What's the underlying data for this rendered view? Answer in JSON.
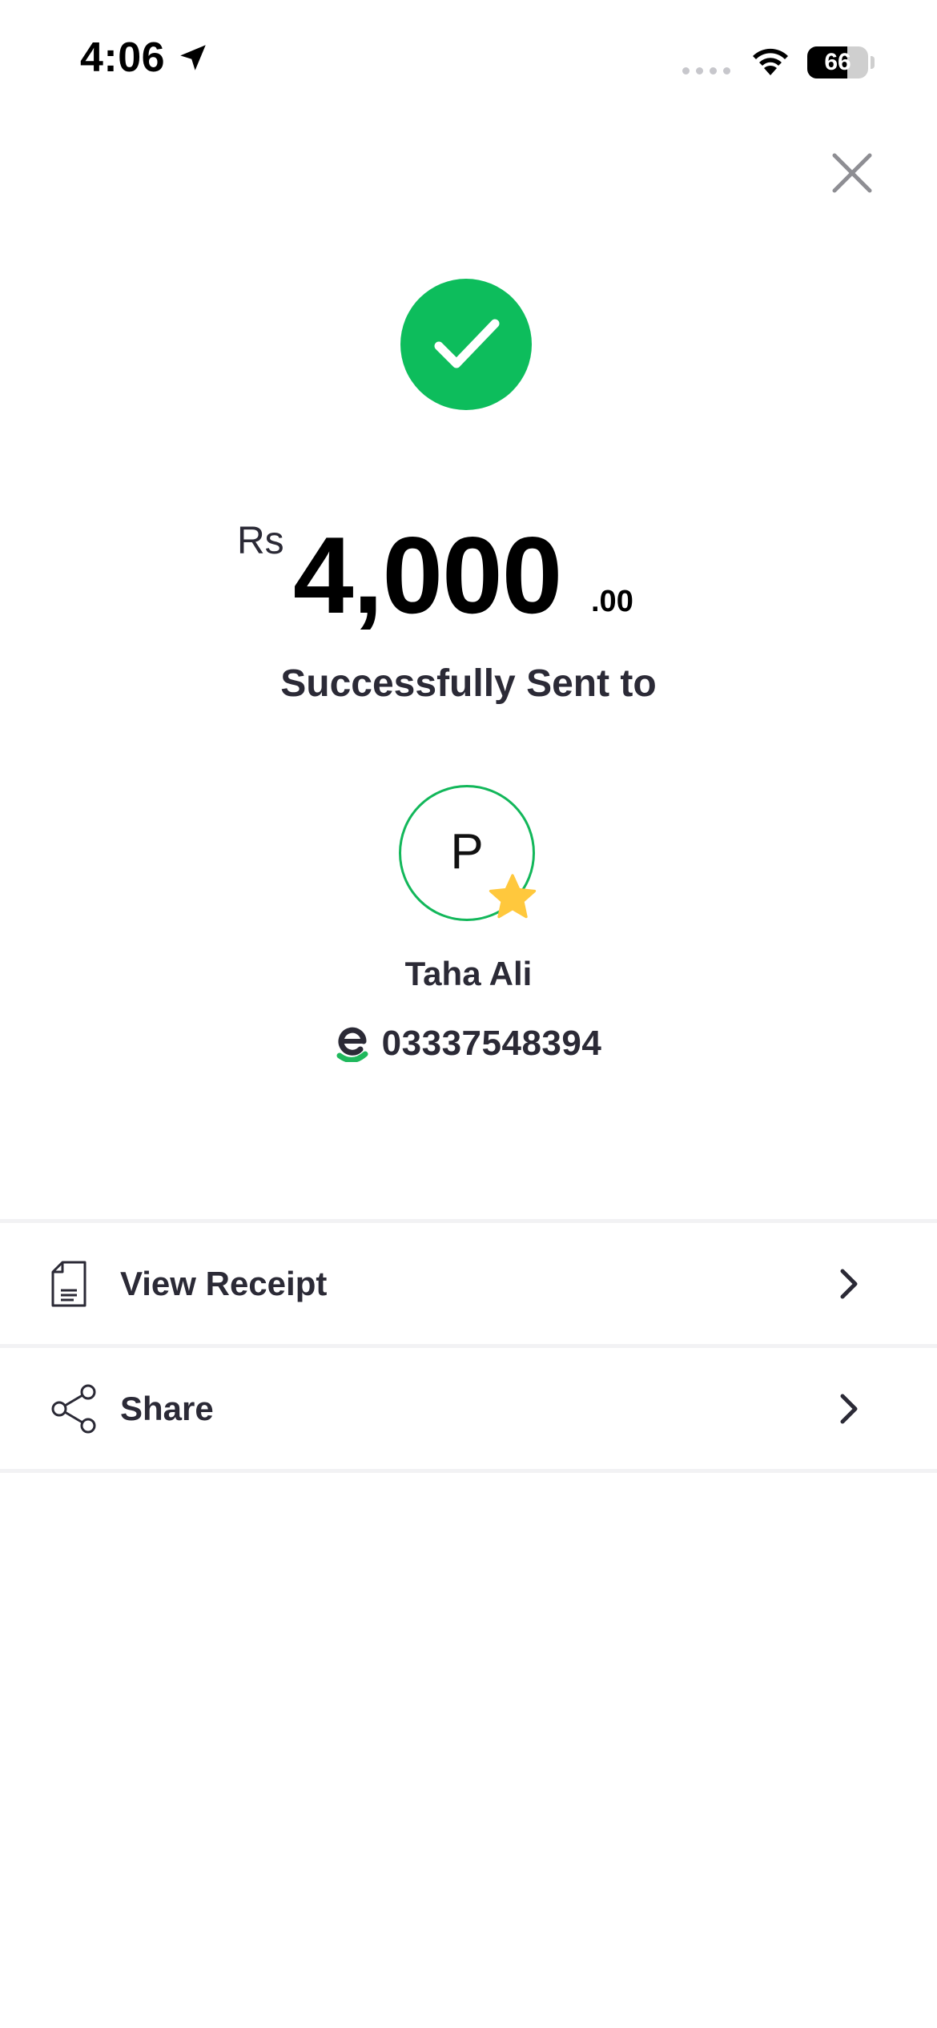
{
  "status_bar": {
    "time": "4:06",
    "battery_percent": "66",
    "battery_level": 0.66
  },
  "icons": {
    "location": "location-arrow-icon",
    "wifi": "wifi-icon",
    "close": "close-icon",
    "success": "check-icon",
    "favorite": "star-icon",
    "wallet": "easypaisa-logo-icon",
    "receipt": "receipt-icon",
    "share": "share-icon",
    "chevron": "chevron-right-icon"
  },
  "colors": {
    "success_green": "#0dbd5c",
    "star_yellow": "#ffc83d",
    "text_dark": "#2b2a36"
  },
  "transaction": {
    "currency": "Rs",
    "amount": "4,000",
    "decimal": ".00",
    "status": "Successfully Sent to"
  },
  "recipient": {
    "initial": "P",
    "name": "Taha Ali",
    "number": "03337548394"
  },
  "actions": {
    "view_receipt": "View Receipt",
    "share": "Share"
  }
}
